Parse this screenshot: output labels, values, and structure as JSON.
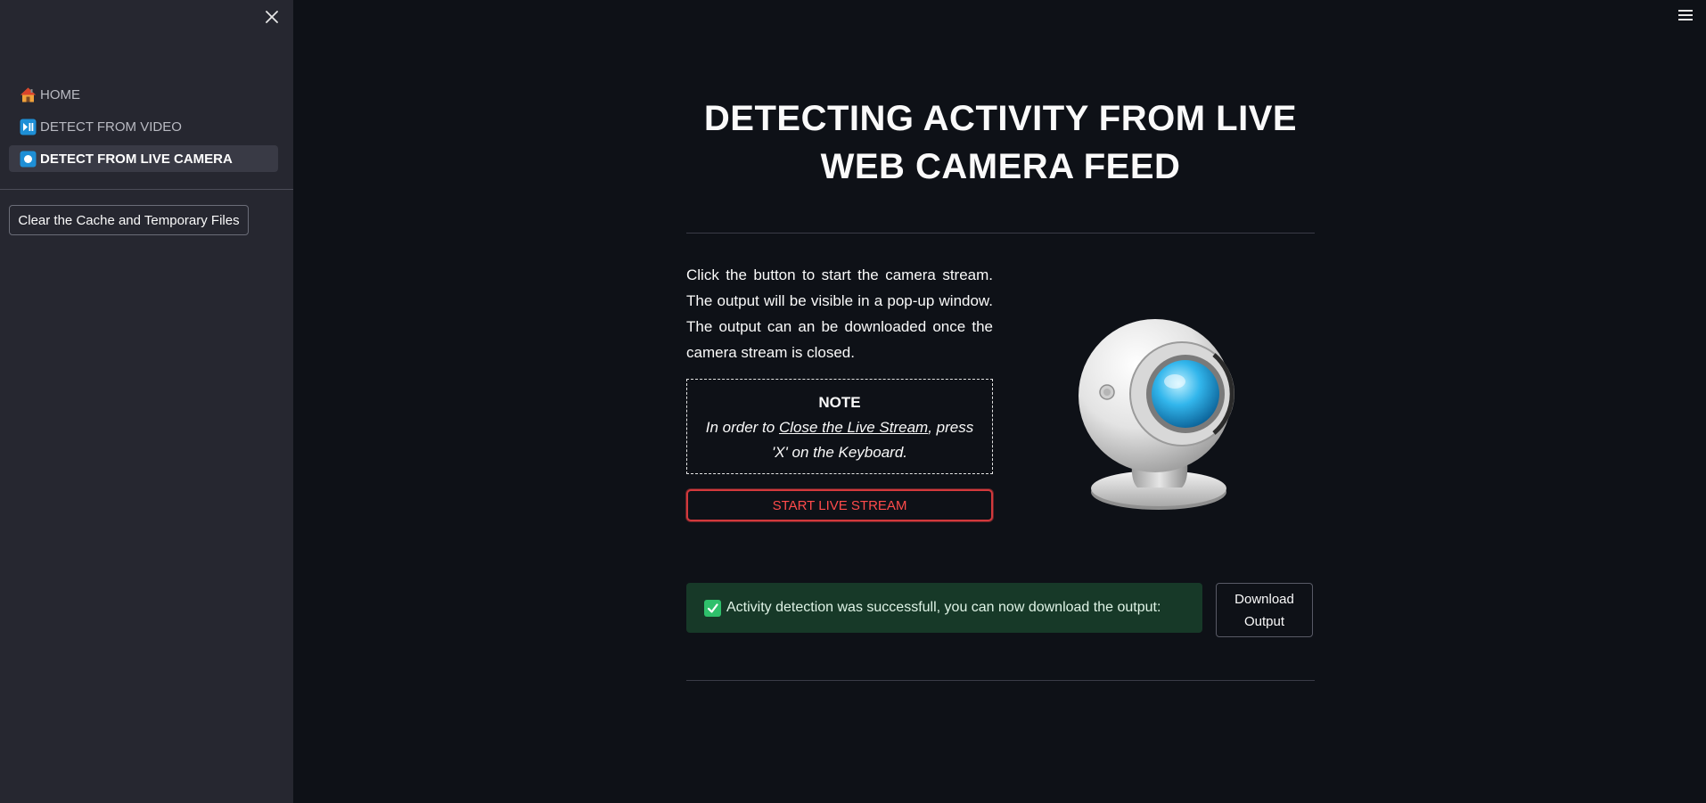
{
  "sidebar": {
    "nav": [
      {
        "label": "HOME",
        "icon": "house-emoji-icon",
        "active": false
      },
      {
        "label": "DETECT FROM VIDEO",
        "icon": "play-pause-icon",
        "active": false
      },
      {
        "label": "DETECT FROM LIVE CAMERA",
        "icon": "record-button-icon",
        "active": true
      }
    ],
    "clear_button": "Clear the Cache and Temporary Files"
  },
  "main": {
    "title_line1": "DETECTING ACTIVITY FROM LIVE",
    "title_line2": "WEB CAMERA FEED",
    "description": "Click the button to start the camera stream. The output will be visible in a pop-up window. The output can an be downloaded once the camera stream is closed.",
    "note": {
      "title": "NOTE",
      "prefix": "In order to ",
      "link": "Close the Live Stream",
      "suffix": ", press 'X' on the Keyboard."
    },
    "start_button": "START LIVE STREAM",
    "success_message": "Activity detection was successfull, you can now download the output:",
    "download_button": "Download Output"
  },
  "colors": {
    "background": "#0e1117",
    "sidebar": "#262730",
    "accent_red": "#ff4b4b",
    "success_bg": "#173928",
    "success_icon": "#2fc06b"
  }
}
